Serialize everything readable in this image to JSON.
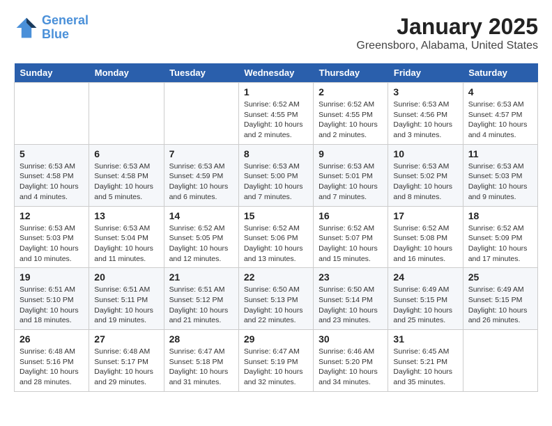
{
  "logo": {
    "line1": "General",
    "line2": "Blue"
  },
  "title": "January 2025",
  "subtitle": "Greensboro, Alabama, United States",
  "weekdays": [
    "Sunday",
    "Monday",
    "Tuesday",
    "Wednesday",
    "Thursday",
    "Friday",
    "Saturday"
  ],
  "weeks": [
    [
      {
        "num": "",
        "text": ""
      },
      {
        "num": "",
        "text": ""
      },
      {
        "num": "",
        "text": ""
      },
      {
        "num": "1",
        "text": "Sunrise: 6:52 AM\nSunset: 4:55 PM\nDaylight: 10 hours and 2 minutes."
      },
      {
        "num": "2",
        "text": "Sunrise: 6:52 AM\nSunset: 4:55 PM\nDaylight: 10 hours and 2 minutes."
      },
      {
        "num": "3",
        "text": "Sunrise: 6:53 AM\nSunset: 4:56 PM\nDaylight: 10 hours and 3 minutes."
      },
      {
        "num": "4",
        "text": "Sunrise: 6:53 AM\nSunset: 4:57 PM\nDaylight: 10 hours and 4 minutes."
      }
    ],
    [
      {
        "num": "5",
        "text": "Sunrise: 6:53 AM\nSunset: 4:58 PM\nDaylight: 10 hours and 4 minutes."
      },
      {
        "num": "6",
        "text": "Sunrise: 6:53 AM\nSunset: 4:58 PM\nDaylight: 10 hours and 5 minutes."
      },
      {
        "num": "7",
        "text": "Sunrise: 6:53 AM\nSunset: 4:59 PM\nDaylight: 10 hours and 6 minutes."
      },
      {
        "num": "8",
        "text": "Sunrise: 6:53 AM\nSunset: 5:00 PM\nDaylight: 10 hours and 7 minutes."
      },
      {
        "num": "9",
        "text": "Sunrise: 6:53 AM\nSunset: 5:01 PM\nDaylight: 10 hours and 7 minutes."
      },
      {
        "num": "10",
        "text": "Sunrise: 6:53 AM\nSunset: 5:02 PM\nDaylight: 10 hours and 8 minutes."
      },
      {
        "num": "11",
        "text": "Sunrise: 6:53 AM\nSunset: 5:03 PM\nDaylight: 10 hours and 9 minutes."
      }
    ],
    [
      {
        "num": "12",
        "text": "Sunrise: 6:53 AM\nSunset: 5:03 PM\nDaylight: 10 hours and 10 minutes."
      },
      {
        "num": "13",
        "text": "Sunrise: 6:53 AM\nSunset: 5:04 PM\nDaylight: 10 hours and 11 minutes."
      },
      {
        "num": "14",
        "text": "Sunrise: 6:52 AM\nSunset: 5:05 PM\nDaylight: 10 hours and 12 minutes."
      },
      {
        "num": "15",
        "text": "Sunrise: 6:52 AM\nSunset: 5:06 PM\nDaylight: 10 hours and 13 minutes."
      },
      {
        "num": "16",
        "text": "Sunrise: 6:52 AM\nSunset: 5:07 PM\nDaylight: 10 hours and 15 minutes."
      },
      {
        "num": "17",
        "text": "Sunrise: 6:52 AM\nSunset: 5:08 PM\nDaylight: 10 hours and 16 minutes."
      },
      {
        "num": "18",
        "text": "Sunrise: 6:52 AM\nSunset: 5:09 PM\nDaylight: 10 hours and 17 minutes."
      }
    ],
    [
      {
        "num": "19",
        "text": "Sunrise: 6:51 AM\nSunset: 5:10 PM\nDaylight: 10 hours and 18 minutes."
      },
      {
        "num": "20",
        "text": "Sunrise: 6:51 AM\nSunset: 5:11 PM\nDaylight: 10 hours and 19 minutes."
      },
      {
        "num": "21",
        "text": "Sunrise: 6:51 AM\nSunset: 5:12 PM\nDaylight: 10 hours and 21 minutes."
      },
      {
        "num": "22",
        "text": "Sunrise: 6:50 AM\nSunset: 5:13 PM\nDaylight: 10 hours and 22 minutes."
      },
      {
        "num": "23",
        "text": "Sunrise: 6:50 AM\nSunset: 5:14 PM\nDaylight: 10 hours and 23 minutes."
      },
      {
        "num": "24",
        "text": "Sunrise: 6:49 AM\nSunset: 5:15 PM\nDaylight: 10 hours and 25 minutes."
      },
      {
        "num": "25",
        "text": "Sunrise: 6:49 AM\nSunset: 5:15 PM\nDaylight: 10 hours and 26 minutes."
      }
    ],
    [
      {
        "num": "26",
        "text": "Sunrise: 6:48 AM\nSunset: 5:16 PM\nDaylight: 10 hours and 28 minutes."
      },
      {
        "num": "27",
        "text": "Sunrise: 6:48 AM\nSunset: 5:17 PM\nDaylight: 10 hours and 29 minutes."
      },
      {
        "num": "28",
        "text": "Sunrise: 6:47 AM\nSunset: 5:18 PM\nDaylight: 10 hours and 31 minutes."
      },
      {
        "num": "29",
        "text": "Sunrise: 6:47 AM\nSunset: 5:19 PM\nDaylight: 10 hours and 32 minutes."
      },
      {
        "num": "30",
        "text": "Sunrise: 6:46 AM\nSunset: 5:20 PM\nDaylight: 10 hours and 34 minutes."
      },
      {
        "num": "31",
        "text": "Sunrise: 6:45 AM\nSunset: 5:21 PM\nDaylight: 10 hours and 35 minutes."
      },
      {
        "num": "",
        "text": ""
      }
    ]
  ]
}
